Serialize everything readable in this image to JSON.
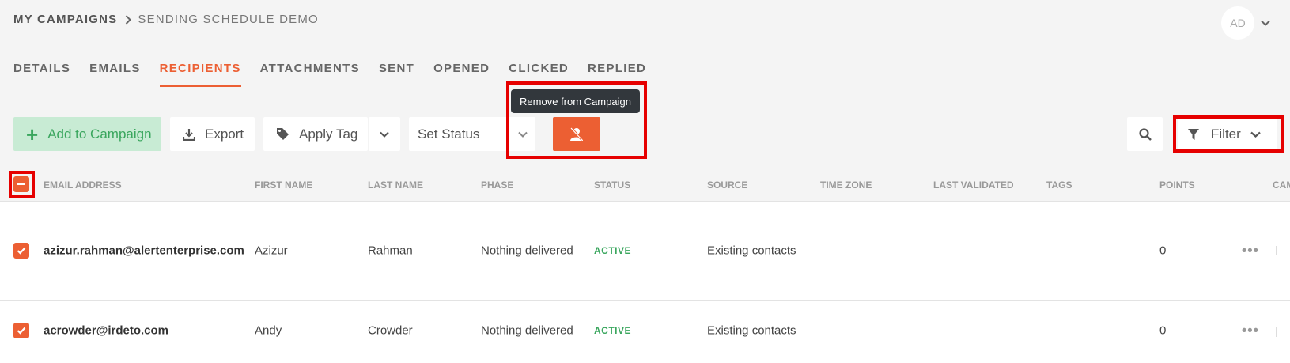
{
  "breadcrumb": {
    "root": "MY CAMPAIGNS",
    "current": "SENDING SCHEDULE DEMO"
  },
  "user": {
    "initials": "AD"
  },
  "tabs": [
    {
      "label": "DETAILS",
      "active": false
    },
    {
      "label": "EMAILS",
      "active": false
    },
    {
      "label": "RECIPIENTS",
      "active": true
    },
    {
      "label": "ATTACHMENTS",
      "active": false
    },
    {
      "label": "SENT",
      "active": false
    },
    {
      "label": "OPENED",
      "active": false
    },
    {
      "label": "CLICKED",
      "active": false
    },
    {
      "label": "REPLIED",
      "active": false
    }
  ],
  "toolbar": {
    "add_label": "Add to Campaign",
    "export_label": "Export",
    "apply_tag_label": "Apply Tag",
    "set_status_label": "Set Status",
    "filter_label": "Filter",
    "remove_tooltip": "Remove from Campaign"
  },
  "table": {
    "columns": [
      "EMAIL ADDRESS",
      "FIRST NAME",
      "LAST NAME",
      "PHASE",
      "STATUS",
      "SOURCE",
      "TIME ZONE",
      "LAST VALIDATED",
      "TAGS",
      "POINTS",
      "CAM"
    ],
    "rows": [
      {
        "email": "azizur.rahman@alertenterprise.com",
        "first_name": "Azizur",
        "last_name": "Rahman",
        "phase": "Nothing delivered",
        "status": "ACTIVE",
        "source": "Existing contacts",
        "points": "0",
        "checked": true
      },
      {
        "email": "acrowder@irdeto.com",
        "first_name": "Andy",
        "last_name": "Crowder",
        "phase": "Nothing delivered",
        "status": "ACTIVE",
        "source": "Existing contacts",
        "points": "0",
        "checked": true
      }
    ]
  },
  "colors": {
    "accent": "#ec5f33",
    "success": "#3aa65e",
    "highlight": "#e60000"
  },
  "icons": [
    "chevron-right-icon",
    "chevron-down-icon",
    "plus-icon",
    "download-icon",
    "tag-icon",
    "remove-user-icon",
    "search-icon",
    "filter-icon",
    "check-icon",
    "more-icon"
  ]
}
